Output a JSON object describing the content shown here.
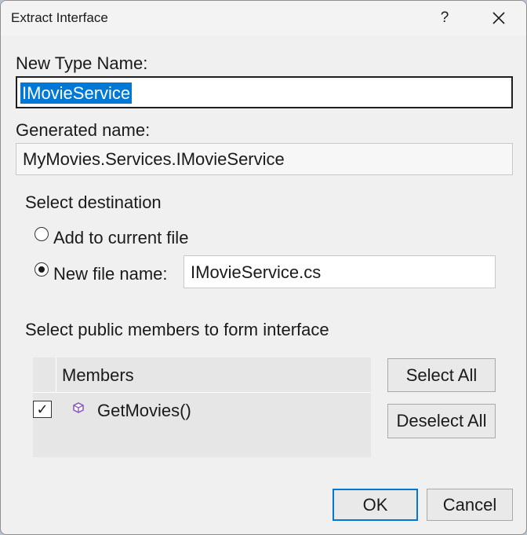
{
  "window": {
    "title": "Extract Interface",
    "help_glyph": "?",
    "close_icon": "close-icon"
  },
  "new_type_name": {
    "label": "New Type Name:",
    "value": "IMovieService"
  },
  "generated_name": {
    "label": "Generated name:",
    "value": "MyMovies.Services.IMovieService"
  },
  "destination": {
    "heading": "Select destination",
    "options": [
      {
        "label": "Add to current file",
        "selected": false
      },
      {
        "label": "New file name:",
        "selected": true
      }
    ],
    "file_name": "IMovieService.cs"
  },
  "members": {
    "heading": "Select public members to form interface",
    "column_header": "Members",
    "items": [
      {
        "name": "GetMovies()",
        "checked": true,
        "icon": "method-icon",
        "icon_color": "#8a5cc7"
      }
    ],
    "check_glyph": "✓"
  },
  "buttons": {
    "select_all": "Select All",
    "deselect_all": "Deselect All",
    "ok": "OK",
    "cancel": "Cancel"
  },
  "colors": {
    "accent": "#0078d7",
    "dialog_bg": "#f0f0f0"
  }
}
